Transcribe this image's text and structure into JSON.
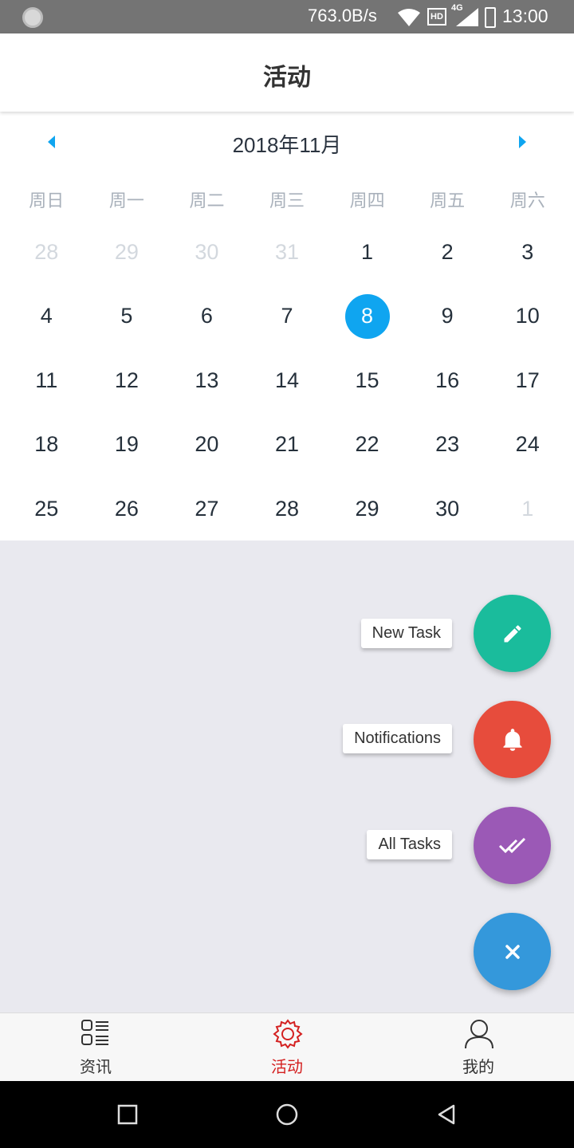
{
  "status_bar": {
    "network_speed": "763.0B/s",
    "hd_badge": "HD",
    "network_type": "4G",
    "time": "13:00"
  },
  "header": {
    "title": "活动"
  },
  "calendar": {
    "month_label": "2018年11月",
    "weekdays": [
      "周日",
      "周一",
      "周二",
      "周三",
      "周四",
      "周五",
      "周六"
    ],
    "selected_day": "8",
    "days": [
      {
        "label": "28",
        "muted": true
      },
      {
        "label": "29",
        "muted": true
      },
      {
        "label": "30",
        "muted": true
      },
      {
        "label": "31",
        "muted": true
      },
      {
        "label": "1",
        "muted": false
      },
      {
        "label": "2",
        "muted": false
      },
      {
        "label": "3",
        "muted": false
      },
      {
        "label": "4",
        "muted": false
      },
      {
        "label": "5",
        "muted": false
      },
      {
        "label": "6",
        "muted": false
      },
      {
        "label": "7",
        "muted": false
      },
      {
        "label": "8",
        "muted": false,
        "selected": true
      },
      {
        "label": "9",
        "muted": false
      },
      {
        "label": "10",
        "muted": false
      },
      {
        "label": "11",
        "muted": false
      },
      {
        "label": "12",
        "muted": false
      },
      {
        "label": "13",
        "muted": false
      },
      {
        "label": "14",
        "muted": false
      },
      {
        "label": "15",
        "muted": false
      },
      {
        "label": "16",
        "muted": false
      },
      {
        "label": "17",
        "muted": false
      },
      {
        "label": "18",
        "muted": false
      },
      {
        "label": "19",
        "muted": false
      },
      {
        "label": "20",
        "muted": false
      },
      {
        "label": "21",
        "muted": false
      },
      {
        "label": "22",
        "muted": false
      },
      {
        "label": "23",
        "muted": false
      },
      {
        "label": "24",
        "muted": false
      },
      {
        "label": "25",
        "muted": false
      },
      {
        "label": "26",
        "muted": false
      },
      {
        "label": "27",
        "muted": false
      },
      {
        "label": "28",
        "muted": false
      },
      {
        "label": "29",
        "muted": false
      },
      {
        "label": "30",
        "muted": false
      },
      {
        "label": "1",
        "muted": true
      }
    ],
    "colors": {
      "accent": "#0fa5f0",
      "muted": "#d3d8de",
      "text": "#25303b"
    }
  },
  "fab_menu": {
    "actions": [
      {
        "label": "New Task",
        "icon": "pencil-icon",
        "color": "#1abc9c"
      },
      {
        "label": "Notifications",
        "icon": "bell-icon",
        "color": "#e74c3c"
      },
      {
        "label": "All Tasks",
        "icon": "double-check-icon",
        "color": "#9b59b6"
      }
    ],
    "close": {
      "icon": "close-icon",
      "color": "#3498db"
    }
  },
  "bottom_nav": {
    "items": [
      {
        "label": "资讯",
        "icon": "news-list-icon",
        "active": false
      },
      {
        "label": "活动",
        "icon": "gear-icon",
        "active": true
      },
      {
        "label": "我的",
        "icon": "person-icon",
        "active": false
      }
    ],
    "active_color": "#d42020"
  }
}
